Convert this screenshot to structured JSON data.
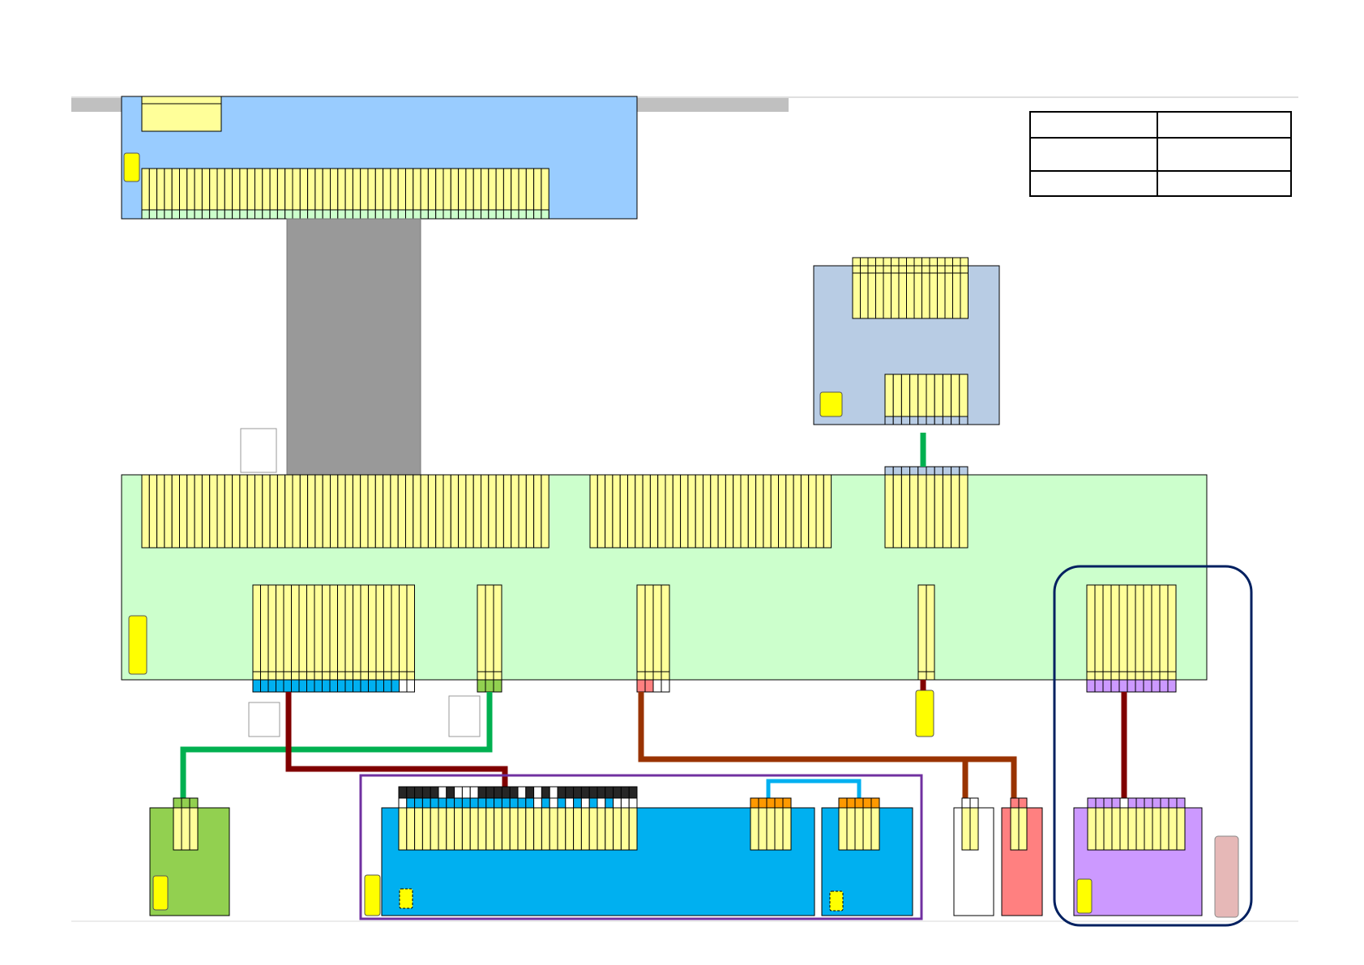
{
  "diagram": {
    "colors": {
      "top_board": "#99ccff",
      "main_board": "#ccffcc",
      "side_board": "#b8cce4",
      "flex_cable": "#999999",
      "header_bar": "#c0c0c0",
      "connector_pin": "#ffff99",
      "chip_marker": "#ffff00",
      "blue_module": "#00b0f0",
      "green_module": "#92d050",
      "red_module": "#ff8080",
      "purple_module": "#cc99ff",
      "pink_part": "#e6b8b7",
      "wire_green": "#00b050",
      "wire_dark_red": "#800000",
      "wire_brown": "#993300",
      "wire_cyan": "#00b0f0",
      "group_frame_purple": "#7030a0",
      "group_frame_navy": "#002060",
      "pin_orange": "#ff9900",
      "pin_black": "#262626"
    },
    "legend_table": {
      "rows": 3,
      "columns": 2,
      "cells": [
        [
          "",
          ""
        ],
        [
          "",
          ""
        ],
        [
          "",
          ""
        ]
      ]
    }
  }
}
